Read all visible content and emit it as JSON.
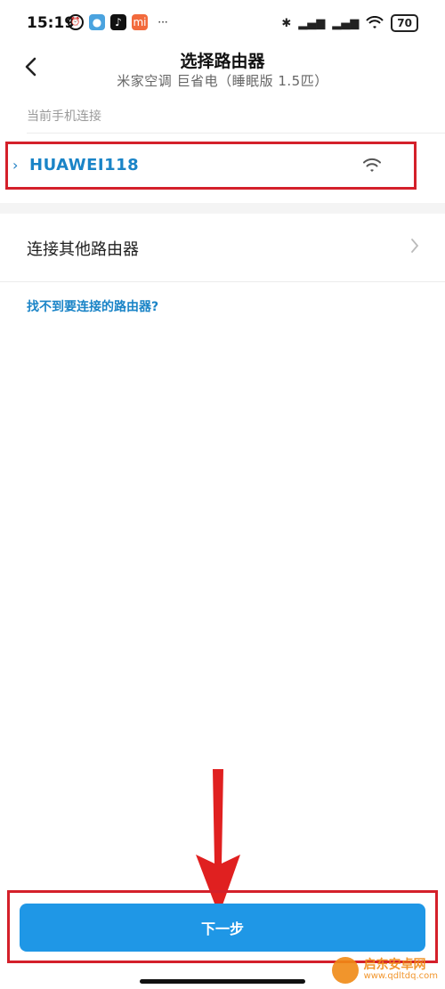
{
  "status_bar": {
    "time": "15:19",
    "battery": "70"
  },
  "header": {
    "title": "选择路由器",
    "subtitle": "米家空调 巨省电（睡眠版 1.5匹）"
  },
  "current_section": {
    "label": "当前手机连接",
    "ssid": "HUAWEI118"
  },
  "other_router": {
    "label": "连接其他路由器"
  },
  "help_link": "找不到要连接的路由器?",
  "next_button": "下一步",
  "watermark": {
    "title": "启东安卓网",
    "url": "www.qdltdq.com"
  },
  "colors": {
    "accent": "#1f97e6",
    "link": "#1a84c7",
    "annotation_red": "#d4202a"
  }
}
